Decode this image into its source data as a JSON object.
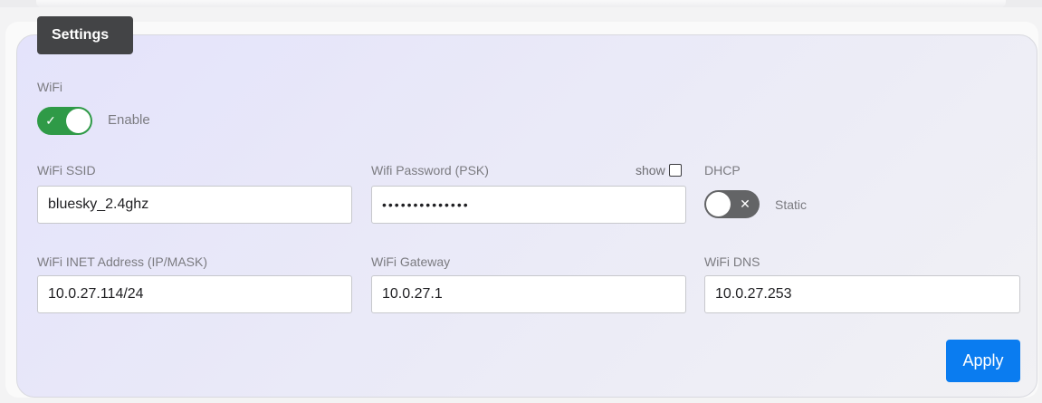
{
  "tab": {
    "title": "Settings"
  },
  "wifi": {
    "section_label": "WiFi",
    "enable_label": "Enable",
    "enabled": true
  },
  "ssid": {
    "label": "WiFi SSID",
    "value": "bluesky_2.4ghz"
  },
  "password": {
    "label": "Wifi Password (PSK)",
    "masked_value": "••••••••••••••",
    "show_label": "show",
    "show_checked": false
  },
  "dhcp": {
    "label": "DHCP",
    "state_label": "Static",
    "enabled": false
  },
  "inet": {
    "label": "WiFi INET Address (IP/MASK)",
    "value": "10.0.27.114/24"
  },
  "gateway": {
    "label": "WiFi Gateway",
    "value": "10.0.27.1"
  },
  "dns": {
    "label": "WiFi DNS",
    "value": "10.0.27.253"
  },
  "apply": {
    "label": "Apply"
  },
  "icons": {
    "toggle_on": "check-icon",
    "toggle_off": "x-icon"
  },
  "colors": {
    "toggle_on": "#2f9a47",
    "toggle_off": "#636466",
    "primary_button": "#0a7cf0",
    "tab_background": "#434446"
  }
}
